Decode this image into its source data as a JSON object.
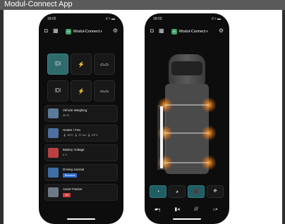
{
  "window": {
    "title": "Modul-Connect App"
  },
  "phone1": {
    "status": {
      "time": "18:02",
      "signal": "ıl ≈ ▬"
    },
    "brand": {
      "logo_text": "M",
      "name": "Modul-Connect",
      "tm": "®"
    },
    "icons": {
      "left1": "vehicle-icon",
      "left2": "grid-icon",
      "right": "gear-icon"
    },
    "tiles": [
      {
        "glyph": "⦚D⦚",
        "icon": "light-bar-icon"
      },
      {
        "glyph": "⚡",
        "icon": "power-icon"
      },
      {
        "glyph": "⌓⌓",
        "icon": "drive-icon"
      },
      {
        "glyph": "⦚D⦚",
        "icon": "light-bar-icon"
      },
      {
        "glyph": "⚡",
        "icon": "power-icon"
      },
      {
        "glyph": "⌓⌓",
        "icon": "drive-icon"
      }
    ],
    "cards": [
      {
        "title": "Vehicle Weighing",
        "sub": "49 %",
        "thumb_color": "#5b7b9a"
      },
      {
        "title": "Heater / Fan",
        "sub": "🌡 18°C    🌡 37 mn    🌡 24°C",
        "thumb_color": "#4e6f9f"
      },
      {
        "title": "Battery Voltage",
        "sub": "0 V",
        "thumb_color": "#b94141"
      },
      {
        "title": "Driving Journal",
        "badge": "Business",
        "badge_color": "#2f6fd1",
        "thumb_color": "#3d6ea6"
      },
      {
        "title": "Asset Tracker",
        "badge": "Off",
        "badge_color": "#d23b3b",
        "thumb_color": "#6d7a86"
      }
    ]
  },
  "phone2": {
    "status": {
      "time": "18:02",
      "signal": "ıl ≈ ▬"
    },
    "brand": {
      "logo_text": "M",
      "name": "Modul-Connect",
      "tm": "®"
    },
    "icons": {
      "left1": "vehicle-icon",
      "left2": "grid-icon",
      "right": "gear-icon"
    },
    "modes": [
      {
        "glyph": "◔",
        "icon": "light-mode-icon"
      },
      {
        "glyph": "◕",
        "icon": "light-mode-icon"
      },
      {
        "glyph": "⬛",
        "icon": "cab-light-icon"
      },
      {
        "glyph": "⛖",
        "icon": "roof-light-icon"
      }
    ],
    "bottom": [
      {
        "glyph": "▰╕",
        "icon": "drill-icon"
      },
      {
        "glyph": "▮◂",
        "icon": "charge-icon"
      },
      {
        "glyph": "///",
        "icon": "heat-icon"
      },
      {
        "glyph": "⌂▪",
        "icon": "camera-icon"
      }
    ]
  }
}
